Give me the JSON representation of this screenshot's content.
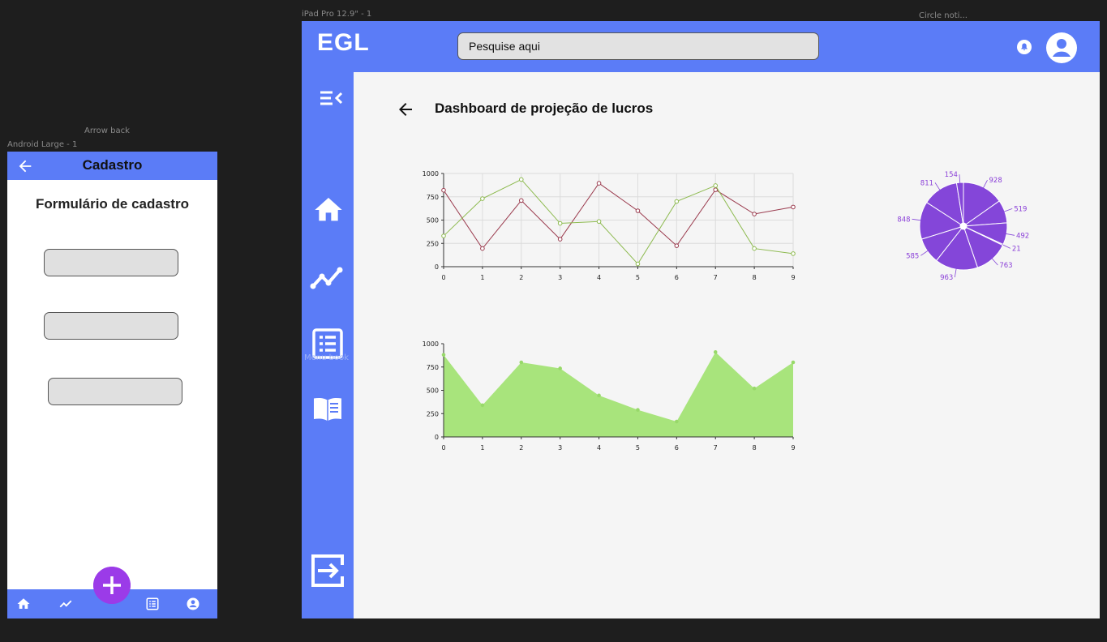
{
  "canvas": {
    "android_frame_label": "Android Large - 1",
    "arrow_back_label": "Arrow back",
    "ipad_frame_label": "iPad Pro 12.9\" - 1",
    "circle_noti_label": "Circle noti...",
    "menu_book_label": "Menu book"
  },
  "android": {
    "title": "Cadastro",
    "form_title": "Formulário de cadastro",
    "nav_items": [
      "home-icon",
      "trending-icon",
      "list-icon",
      "account-icon"
    ],
    "fab_icon": "plus-icon"
  },
  "ipad": {
    "logo": "EGL",
    "search_placeholder": "Pesquise aqui",
    "page_title": "Dashboard de projeção de  lucros",
    "sidebar_items": [
      "menu-collapse-icon",
      "home-icon",
      "trending-icon",
      "list-icon",
      "menu-book-icon",
      "logout-icon"
    ]
  },
  "colors": {
    "brand_blue": "#5b7cf7",
    "fab_purple": "#9b3be8",
    "series_green": "#8dba4f",
    "series_red": "#9a3a4d",
    "area_green": "#a8e47c",
    "pie_purple": "#8446d9"
  },
  "chart_data": [
    {
      "type": "line",
      "x": [
        0,
        1,
        2,
        3,
        4,
        5,
        6,
        7,
        8,
        9
      ],
      "series": [
        {
          "values": [
            820,
            195,
            710,
            295,
            895,
            600,
            225,
            825,
            565,
            640
          ]
        },
        {
          "values": [
            330,
            730,
            935,
            465,
            485,
            30,
            700,
            870,
            195,
            140
          ]
        }
      ],
      "ylim": [
        0,
        1000
      ],
      "yticks": [
        0,
        250,
        500,
        750,
        1000
      ],
      "grid": true
    },
    {
      "type": "area",
      "x": [
        0,
        1,
        2,
        3,
        4,
        5,
        6,
        7,
        8,
        9
      ],
      "values": [
        880,
        340,
        800,
        735,
        445,
        290,
        165,
        910,
        520,
        800
      ],
      "ylim": [
        0,
        1000
      ],
      "yticks": [
        0,
        250,
        500,
        750,
        1000
      ]
    },
    {
      "type": "pie",
      "values": [
        928,
        519,
        492,
        21,
        763,
        963,
        585,
        848,
        811,
        154
      ]
    }
  ]
}
